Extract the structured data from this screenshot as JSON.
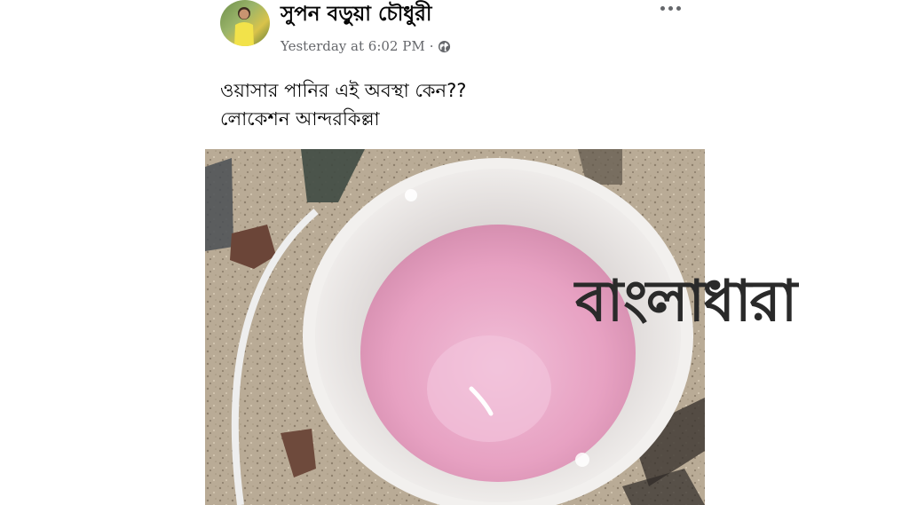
{
  "post": {
    "author": "সুপন বড়ুয়া চৌধুরী",
    "timestamp": "Yesterday at 6:02 PM",
    "separator": "·",
    "privacy_icon": "globe-icon",
    "more_icon": "more-options-icon",
    "text_lines": [
      "ওয়াসার পানির এই অবস্থা কেন??",
      "লোকেশন আন্দরকিল্লা"
    ]
  },
  "photo": {
    "description_icon": "bucket-photo",
    "water_color": "#e8a8c8",
    "bucket_color": "#e9e7e4"
  },
  "watermark": {
    "logo_text_part1": "বা",
    "logo_text_part2": "ং",
    "logo_text_part3": "লাধারা",
    "accent": "#d12a2a",
    "main": "#2a2a2a"
  }
}
